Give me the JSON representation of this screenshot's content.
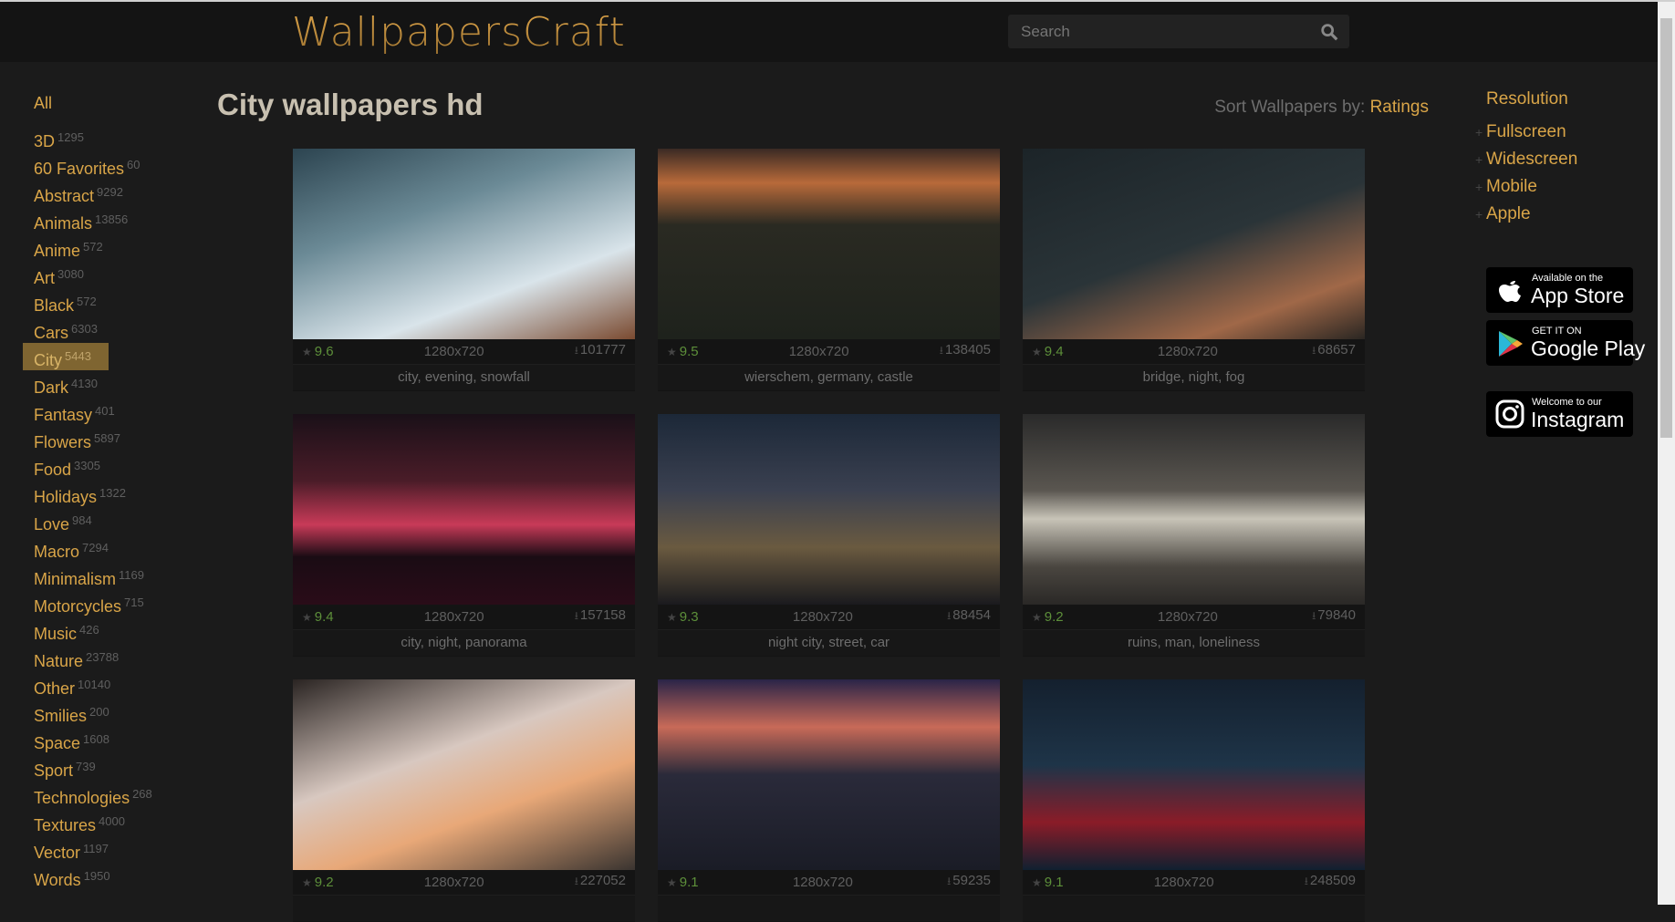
{
  "header": {
    "logo": "WallpapersCraft",
    "search_placeholder": "Search"
  },
  "sidebar": {
    "all": "All",
    "categories": [
      {
        "label": "3D",
        "count": "1295"
      },
      {
        "label": "60 Favorites",
        "count": "60"
      },
      {
        "label": "Abstract",
        "count": "9292"
      },
      {
        "label": "Animals",
        "count": "13856"
      },
      {
        "label": "Anime",
        "count": "572"
      },
      {
        "label": "Art",
        "count": "3080"
      },
      {
        "label": "Black",
        "count": "572"
      },
      {
        "label": "Cars",
        "count": "6303"
      },
      {
        "label": "City",
        "count": "5443",
        "active": true
      },
      {
        "label": "Dark",
        "count": "4130"
      },
      {
        "label": "Fantasy",
        "count": "401"
      },
      {
        "label": "Flowers",
        "count": "5897"
      },
      {
        "label": "Food",
        "count": "3305"
      },
      {
        "label": "Holidays",
        "count": "1322"
      },
      {
        "label": "Love",
        "count": "984"
      },
      {
        "label": "Macro",
        "count": "7294"
      },
      {
        "label": "Minimalism",
        "count": "1169"
      },
      {
        "label": "Motorcycles",
        "count": "715"
      },
      {
        "label": "Music",
        "count": "426"
      },
      {
        "label": "Nature",
        "count": "23788"
      },
      {
        "label": "Other",
        "count": "10140"
      },
      {
        "label": "Smilies",
        "count": "200"
      },
      {
        "label": "Space",
        "count": "1608"
      },
      {
        "label": "Sport",
        "count": "739"
      },
      {
        "label": "Technologies",
        "count": "268"
      },
      {
        "label": "Textures",
        "count": "4000"
      },
      {
        "label": "Vector",
        "count": "1197"
      },
      {
        "label": "Words",
        "count": "1950"
      }
    ]
  },
  "main": {
    "title": "City wallpapers hd",
    "sort_label": "Sort Wallpapers by:",
    "sort_value": "Ratings",
    "wallpapers": [
      {
        "rating": "9.6",
        "resolution": "1280x720",
        "downloads": "101777",
        "tags": "city, evening, snowfall",
        "bg": "linear-gradient(160deg,#2c4450 0%,#6b8a96 35%,#d9e4ea 70%,#7a4a30 100%)"
      },
      {
        "rating": "9.5",
        "resolution": "1280x720",
        "downloads": "138405",
        "tags": "wierschem, germany, castle",
        "bg": "linear-gradient(180deg,#3a2a24 0%,#b86a3a 18%,#2a2a22 40%,#1e221c 100%)"
      },
      {
        "rating": "9.4",
        "resolution": "1280x720",
        "downloads": "68657",
        "tags": "bridge, night, fog",
        "bg": "linear-gradient(160deg,#1c2428 0%,#2a3438 50%,#a06848 80%,#2a2622 100%)"
      },
      {
        "rating": "9.4",
        "resolution": "1280x720",
        "downloads": "157158",
        "tags": "city, night, panorama",
        "bg": "linear-gradient(180deg,#1a1018 0%,#4a1c28 35%,#c83a58 58%,#1a0c14 75%,#2a0c18 100%)"
      },
      {
        "rating": "9.3",
        "resolution": "1280x720",
        "downloads": "88454",
        "tags": "night city, street, car",
        "bg": "linear-gradient(180deg,#1c2838 0%,#3a4050 40%,#6a5a40 70%,#1a1a1e 100%)"
      },
      {
        "rating": "9.2",
        "resolution": "1280x720",
        "downloads": "79840",
        "tags": "ruins, man, loneliness",
        "bg": "linear-gradient(180deg,#2a2a2a 0%,#5a5650 40%,#c8c4b8 55%,#4a4640 80%,#2a2826 100%)"
      },
      {
        "rating": "9.2",
        "resolution": "1280x720",
        "downloads": "227052",
        "tags": "",
        "bg": "linear-gradient(160deg,#2a2422 0%,#d8c8c0 40%,#e8a878 65%,#3a3430 100%)"
      },
      {
        "rating": "9.1",
        "resolution": "1280x720",
        "downloads": "59235",
        "tags": "",
        "bg": "linear-gradient(180deg,#2a2448 0%,#c86a58 25%,#2a2a3a 50%,#1a1c26 100%)"
      },
      {
        "rating": "9.1",
        "resolution": "1280x720",
        "downloads": "248509",
        "tags": "",
        "bg": "linear-gradient(180deg,#14202e 0%,#1e3448 45%,#8a1c28 75%,#102030 100%)"
      }
    ]
  },
  "right": {
    "resolution_title": "Resolution",
    "resolutions": [
      "Fullscreen",
      "Widescreen",
      "Mobile",
      "Apple"
    ],
    "appstore": {
      "small": "Available on the",
      "big": "App Store"
    },
    "googleplay": {
      "small": "GET IT ON",
      "big": "Google Play"
    },
    "instagram": {
      "small": "Welcome to our",
      "big": "Instagram"
    }
  }
}
